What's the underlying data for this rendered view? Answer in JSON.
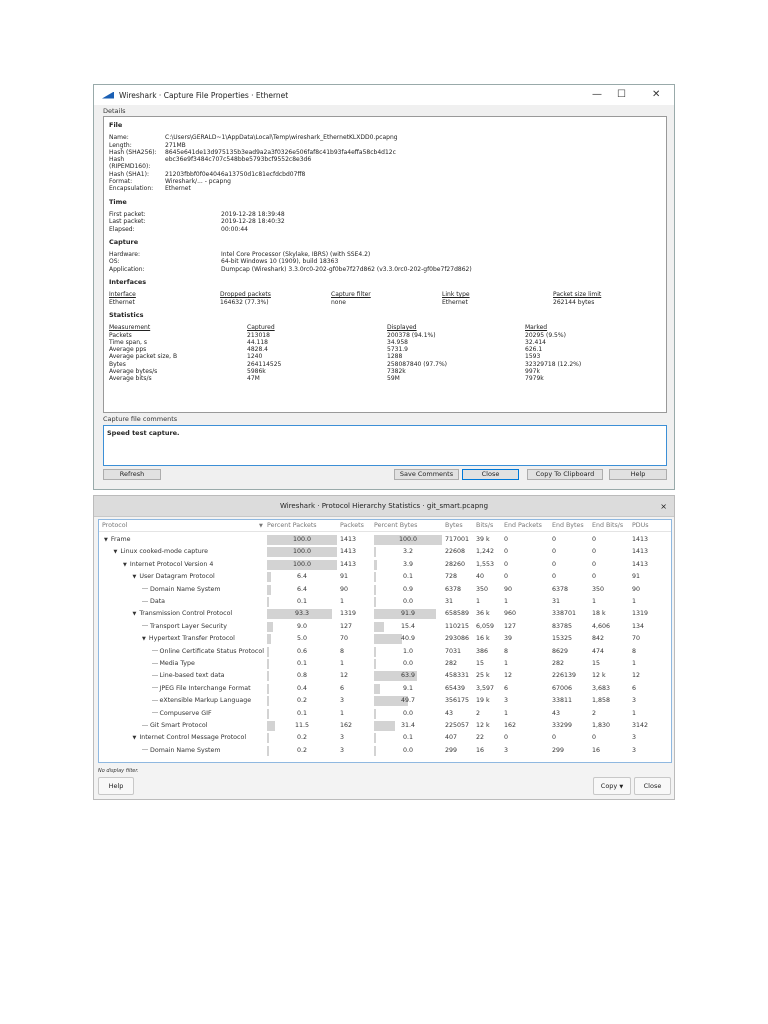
{
  "props": {
    "title": "Wireshark · Capture File Properties · Ethernet",
    "details_label": "Details",
    "file": {
      "heading": "File",
      "rows": [
        [
          "Name:",
          "C:\\Users\\GERALD~1\\AppData\\Local\\Temp\\wireshark_EthernetKLXDD0.pcapng"
        ],
        [
          "Length:",
          "271MB"
        ],
        [
          "Hash (SHA256):",
          "8645e641de13d975135b3ead9a2a3f0326e506faf8c41b93fa4effa58cb4d12c"
        ],
        [
          "Hash (RIPEMD160):",
          "ebc36e9f3484c707c548bbe5793bcf9552c8e3d6"
        ],
        [
          "Hash (SHA1):",
          "21203fbbf0f0e4046a13750d1c81ecfdcbd07ff8"
        ],
        [
          "Format:",
          "Wireshark/... - pcapng"
        ],
        [
          "Encapsulation:",
          "Ethernet"
        ]
      ]
    },
    "time": {
      "heading": "Time",
      "rows": [
        [
          "First packet:",
          "2019-12-28 18:39:48"
        ],
        [
          "Last packet:",
          "2019-12-28 18:40:32"
        ],
        [
          "Elapsed:",
          "00:00:44"
        ]
      ]
    },
    "capture": {
      "heading": "Capture",
      "rows": [
        [
          "Hardware:",
          "Intel Core Processor (Skylake, IBRS) (with SSE4.2)"
        ],
        [
          "OS:",
          "64-bit Windows 10 (1909), build 18363"
        ],
        [
          "Application:",
          "Dumpcap (Wireshark) 3.3.0rc0-202-gf0be7f27d862 (v3.3.0rc0-202-gf0be7f27d862)"
        ]
      ]
    },
    "interfaces": {
      "heading": "Interfaces",
      "headers": [
        "Interface",
        "Dropped packets",
        "Capture filter",
        "Link type",
        "Packet size limit"
      ],
      "values": [
        "Ethernet",
        "164632 (77.3%)",
        "none",
        "Ethernet",
        "262144 bytes"
      ]
    },
    "statistics": {
      "heading": "Statistics",
      "headers": [
        "Measurement",
        "Captured",
        "Displayed",
        "Marked"
      ],
      "rows": [
        [
          "Packets",
          "213018",
          "200378 (94.1%)",
          "20295 (9.5%)"
        ],
        [
          "Time span, s",
          "44.118",
          "34.958",
          "32.414"
        ],
        [
          "Average pps",
          "4828.4",
          "5731.9",
          "626.1"
        ],
        [
          "Average packet size, B",
          "1240",
          "1288",
          "1593"
        ],
        [
          "Bytes",
          "264114525",
          "258087840 (97.7%)",
          "32329718 (12.2%)"
        ],
        [
          "Average bytes/s",
          "5986k",
          "7382k",
          "997k"
        ],
        [
          "Average bits/s",
          "47M",
          "59M",
          "7979k"
        ]
      ]
    },
    "comments_label": "Capture file comments",
    "comments": "Speed test capture.",
    "buttons": {
      "refresh": "Refresh",
      "save": "Save Comments",
      "close": "Close",
      "copy": "Copy To Clipboard",
      "help": "Help"
    }
  },
  "hier": {
    "title": "Wireshark · Protocol Hierarchy Statistics · git_smart.pcapng",
    "close_glyph": "×",
    "columns": [
      "Protocol",
      "Percent Packets",
      "Packets",
      "Percent Bytes",
      "Bytes",
      "Bits/s",
      "End Packets",
      "End Bytes",
      "End Bits/s",
      "PDUs"
    ],
    "rows": [
      {
        "name": "Frame",
        "level": 0,
        "exp": true,
        "v": [
          "100.0",
          "1413",
          "100.0",
          "717001",
          "39 k",
          "0",
          "0",
          "0",
          "1413"
        ]
      },
      {
        "name": "Linux cooked-mode capture",
        "level": 1,
        "exp": true,
        "v": [
          "100.0",
          "1413",
          "3.2",
          "22608",
          "1,242",
          "0",
          "0",
          "0",
          "1413"
        ]
      },
      {
        "name": "Internet Protocol Version 4",
        "level": 2,
        "exp": true,
        "v": [
          "100.0",
          "1413",
          "3.9",
          "28260",
          "1,553",
          "0",
          "0",
          "0",
          "1413"
        ]
      },
      {
        "name": "User Datagram Protocol",
        "level": 3,
        "exp": true,
        "v": [
          "6.4",
          "91",
          "0.1",
          "728",
          "40",
          "0",
          "0",
          "0",
          "91"
        ]
      },
      {
        "name": "Domain Name System",
        "level": 4,
        "exp": false,
        "v": [
          "6.4",
          "90",
          "0.9",
          "6378",
          "350",
          "90",
          "6378",
          "350",
          "90"
        ]
      },
      {
        "name": "Data",
        "level": 4,
        "exp": false,
        "v": [
          "0.1",
          "1",
          "0.0",
          "31",
          "1",
          "1",
          "31",
          "1",
          "1"
        ]
      },
      {
        "name": "Transmission Control Protocol",
        "level": 3,
        "exp": true,
        "v": [
          "93.3",
          "1319",
          "91.9",
          "658589",
          "36 k",
          "960",
          "338701",
          "18 k",
          "1319"
        ]
      },
      {
        "name": "Transport Layer Security",
        "level": 4,
        "exp": false,
        "v": [
          "9.0",
          "127",
          "15.4",
          "110215",
          "6,059",
          "127",
          "83785",
          "4,606",
          "134"
        ]
      },
      {
        "name": "Hypertext Transfer Protocol",
        "level": 4,
        "exp": true,
        "v": [
          "5.0",
          "70",
          "40.9",
          "293086",
          "16 k",
          "39",
          "15325",
          "842",
          "70"
        ]
      },
      {
        "name": "Online Certificate Status Protocol",
        "level": 5,
        "exp": false,
        "v": [
          "0.6",
          "8",
          "1.0",
          "7031",
          "386",
          "8",
          "8629",
          "474",
          "8"
        ]
      },
      {
        "name": "Media Type",
        "level": 5,
        "exp": false,
        "v": [
          "0.1",
          "1",
          "0.0",
          "282",
          "15",
          "1",
          "282",
          "15",
          "1"
        ]
      },
      {
        "name": "Line-based text data",
        "level": 5,
        "exp": false,
        "v": [
          "0.8",
          "12",
          "63.9",
          "458331",
          "25 k",
          "12",
          "226139",
          "12 k",
          "12"
        ]
      },
      {
        "name": "JPEG File Interchange Format",
        "level": 5,
        "exp": false,
        "v": [
          "0.4",
          "6",
          "9.1",
          "65439",
          "3,597",
          "6",
          "67006",
          "3,683",
          "6"
        ]
      },
      {
        "name": "eXtensible Markup Language",
        "level": 5,
        "exp": false,
        "v": [
          "0.2",
          "3",
          "49.7",
          "356175",
          "19 k",
          "3",
          "33811",
          "1,858",
          "3"
        ]
      },
      {
        "name": "Compuserve GIF",
        "level": 5,
        "exp": false,
        "v": [
          "0.1",
          "1",
          "0.0",
          "43",
          "2",
          "1",
          "43",
          "2",
          "1"
        ]
      },
      {
        "name": "Git Smart Protocol",
        "level": 4,
        "exp": false,
        "v": [
          "11.5",
          "162",
          "31.4",
          "225057",
          "12 k",
          "162",
          "33299",
          "1,830",
          "3142"
        ]
      },
      {
        "name": "Internet Control Message Protocol",
        "level": 3,
        "exp": true,
        "v": [
          "0.2",
          "3",
          "0.1",
          "407",
          "22",
          "0",
          "0",
          "0",
          "3"
        ]
      },
      {
        "name": "Domain Name System",
        "level": 4,
        "exp": false,
        "v": [
          "0.2",
          "3",
          "0.0",
          "299",
          "16",
          "3",
          "299",
          "16",
          "3"
        ]
      }
    ],
    "filter_status": "No display filter.",
    "buttons": {
      "help": "Help",
      "copy": "Copy",
      "close": "Close"
    }
  }
}
